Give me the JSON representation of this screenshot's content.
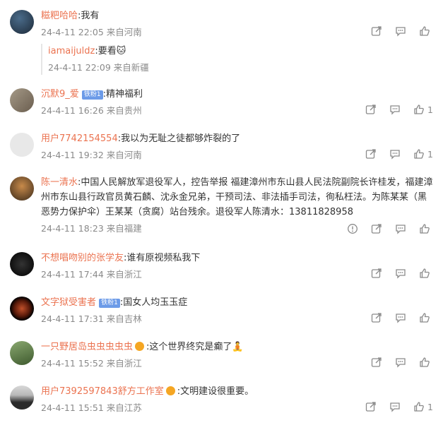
{
  "comments": [
    {
      "user": "糍粑哈哈",
      "text": "我有",
      "time": "24-4-11 22:05",
      "loc": "来自河南",
      "likes": "",
      "reply": {
        "user": "iamaijuldz",
        "text": "要看",
        "emoji": "🐱",
        "time": "24-4-11 22:09",
        "loc": "来自新疆"
      }
    },
    {
      "user": "沉默9_爱",
      "badge": "铁粉1",
      "text": "精神福利",
      "time": "24-4-11 16:26",
      "loc": "来自贵州",
      "likes": "1"
    },
    {
      "user": "用户7742154554",
      "text": "我以为无耻之徒都够炸裂的了",
      "time": "24-4-11 19:32",
      "loc": "来自河南",
      "likes": "1"
    },
    {
      "user": "陈一清水",
      "text": "中国人民解放军退役军人，控告举报 福建漳州市东山县人民法院副院长许桂发，福建漳州市东山县行政官员黄石麟、沈永金兄弟，干预司法、非法插手司法，徇私枉法。为陈某某（黑恶势力保护伞）王某某（贪腐）站台残余。退役军人陈清水：13811828958",
      "time": "24-4-11 18:23",
      "loc": "来自福建",
      "likes": ""
    },
    {
      "user": "不想唱吻别的张学友",
      "text": "谁有原视频私我下",
      "time": "24-4-11 17:44",
      "loc": "来自浙江",
      "likes": ""
    },
    {
      "user": "文字狱受害者",
      "badge": "铁粉1",
      "text": "国女人均玉玉症",
      "time": "24-4-11 17:31",
      "loc": "来自吉林",
      "likes": ""
    },
    {
      "user": "一只野居岛虫虫虫虫虫",
      "text": "这个世界终究是癫了",
      "emoji": "🧘",
      "time": "24-4-11 15:52",
      "loc": "来自浙江",
      "likes": ""
    },
    {
      "user": "用户7392597843舒方工作室",
      "text": "文明建设很重要。",
      "time": "24-4-11 15:51",
      "loc": "来自江苏",
      "likes": "1"
    }
  ],
  "colors": {
    "username": "#eb7350",
    "meta": "#8a8a8a",
    "badge": "#6c9be8"
  },
  "icons": [
    "share-icon",
    "comment-icon",
    "like-icon",
    "report-icon"
  ]
}
